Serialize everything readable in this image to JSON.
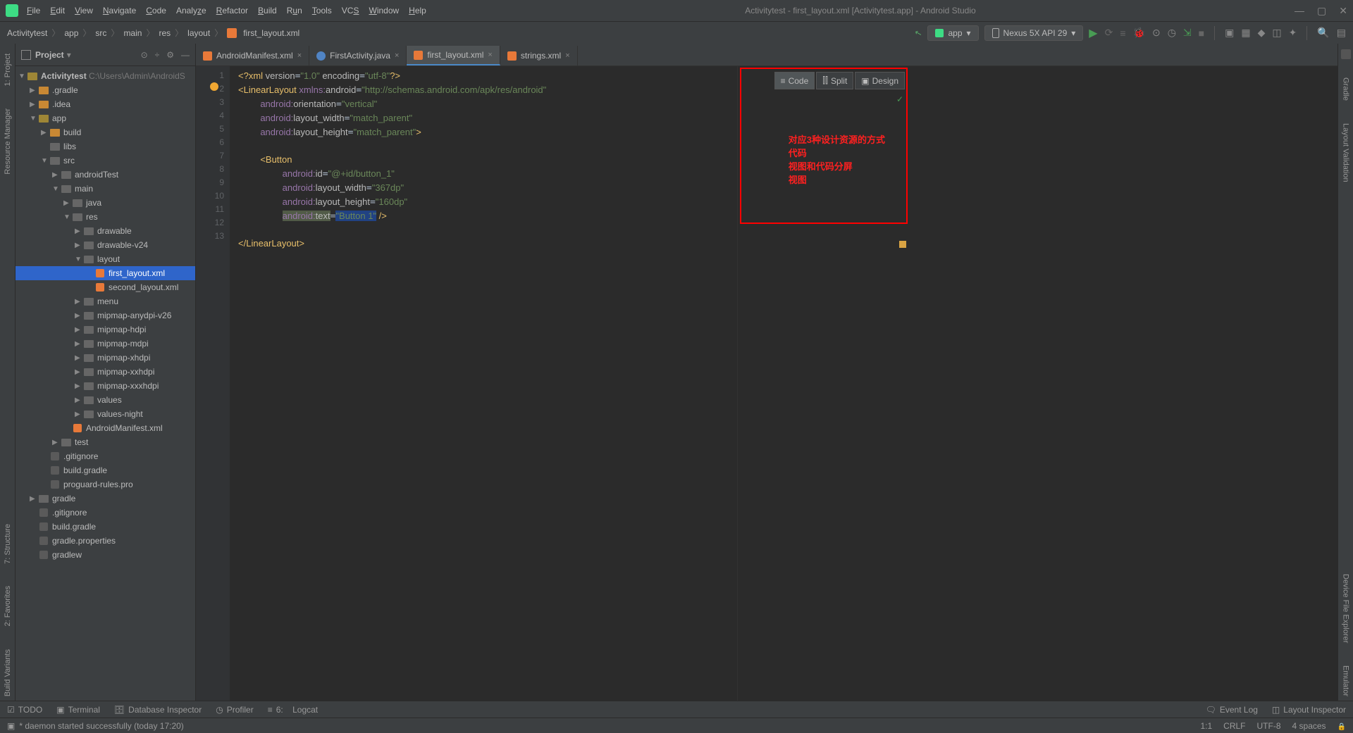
{
  "menus": [
    "File",
    "Edit",
    "View",
    "Navigate",
    "Code",
    "Analyze",
    "Refactor",
    "Build",
    "Run",
    "Tools",
    "VCS",
    "Window",
    "Help"
  ],
  "window_title": "Activitytest - first_layout.xml [Activitytest.app] - Android Studio",
  "breadcrumb": [
    "Activitytest",
    "app",
    "src",
    "main",
    "res",
    "layout",
    "first_layout.xml"
  ],
  "run_config": "app",
  "device": "Nexus 5X API 29",
  "project_label": "Project",
  "project_root": "Activitytest",
  "project_root_path": "C:\\Users\\Admin\\AndroidS",
  "tree": {
    "gradle": ".gradle",
    "idea": ".idea",
    "app": "app",
    "build": "build",
    "libs": "libs",
    "src": "src",
    "androidTest": "androidTest",
    "main": "main",
    "java": "java",
    "res": "res",
    "drawable": "drawable",
    "drawable_v24": "drawable-v24",
    "layout": "layout",
    "first_layout": "first_layout.xml",
    "second_layout": "second_layout.xml",
    "menu": "menu",
    "mipmap_anydpi": "mipmap-anydpi-v26",
    "mipmap_hdpi": "mipmap-hdpi",
    "mipmap_mdpi": "mipmap-mdpi",
    "mipmap_xhdpi": "mipmap-xhdpi",
    "mipmap_xxhdpi": "mipmap-xxhdpi",
    "mipmap_xxxhdpi": "mipmap-xxxhdpi",
    "values": "values",
    "values_night": "values-night",
    "manifest": "AndroidManifest.xml",
    "test": "test",
    "gitignore": ".gitignore",
    "build_gradle": "build.gradle",
    "proguard": "proguard-rules.pro",
    "gradle_root": "gradle",
    "gitignore2": ".gitignore",
    "build_gradle2": "build.gradle",
    "gradle_props": "gradle.properties",
    "gradlew": "gradlew"
  },
  "tabs": [
    {
      "name": "AndroidManifest.xml",
      "type": "xml"
    },
    {
      "name": "FirstActivity.java",
      "type": "java"
    },
    {
      "name": "first_layout.xml",
      "type": "xml",
      "active": true
    },
    {
      "name": "strings.xml",
      "type": "xml"
    }
  ],
  "line_numbers": [
    1,
    2,
    3,
    4,
    5,
    6,
    7,
    8,
    9,
    10,
    11,
    12,
    13
  ],
  "code_raw": {
    "l1_a": "<?xml ",
    "l1_attr1": "version",
    "l1_v1": "\"1.0\"",
    "l1_attr2": " encoding",
    "l1_v2": "\"utf-8\"",
    "l1_end": "?>",
    "l2_a": "<",
    "l2_tag": "LinearLayout ",
    "l2_ns": "xmlns:",
    "l2_attr": "android",
    "l2_v": "\"http://schemas.android.com/apk/res/android\"",
    "l3_ns": "android:",
    "l3_a": "orientation",
    "l3_v": "\"vertical\"",
    "l4_ns": "android:",
    "l4_a": "layout_width",
    "l4_v": "\"match_parent\"",
    "l5_ns": "android:",
    "l5_a": "layout_height",
    "l5_v": "\"match_parent\"",
    "l5_end": ">",
    "l7_a": "<",
    "l7_tag": "Button",
    "l8_ns": "android:",
    "l8_a": "id",
    "l8_v": "\"@+id/button_1\"",
    "l9_ns": "android:",
    "l9_a": "layout_width",
    "l9_v": "\"367dp\"",
    "l10_ns": "android:",
    "l10_a": "layout_height",
    "l10_v": "\"160dp\"",
    "l11_ns": "android:",
    "l11_a": "text",
    "l11_v": "\"Button 1\"",
    "l11_end": " />",
    "l13": "</",
    "l13_tag": "LinearLayout",
    "l13_end": ">"
  },
  "view_modes": {
    "code": "Code",
    "split": "Split",
    "design": "Design"
  },
  "annotations": {
    "title": "对应3种设计资源的方式",
    "code": "代码",
    "split": "视图和代码分屏",
    "design": "视图"
  },
  "bottom_tools": {
    "todo": "TODO",
    "terminal": "Terminal",
    "db": "Database Inspector",
    "profiler": "Profiler",
    "logcat": "Logcat",
    "logcat_num": "6:",
    "eventlog": "Event Log",
    "layoutinsp": "Layout Inspector"
  },
  "status": {
    "msg": "* daemon started successfully (today 17:20)",
    "pos": "1:1",
    "crlf": "CRLF",
    "enc": "UTF-8",
    "indent": "4 spaces"
  },
  "left_labels": {
    "project": "1: Project",
    "resmgr": "Resource Manager",
    "structure": "7: Structure",
    "favorites": "2: Favorites",
    "buildvar": "Build Variants"
  },
  "right_labels": {
    "gradle": "Gradle",
    "layoutval": "Layout Validation",
    "devexp": "Device File Explorer",
    "emulator": "Emulator"
  }
}
